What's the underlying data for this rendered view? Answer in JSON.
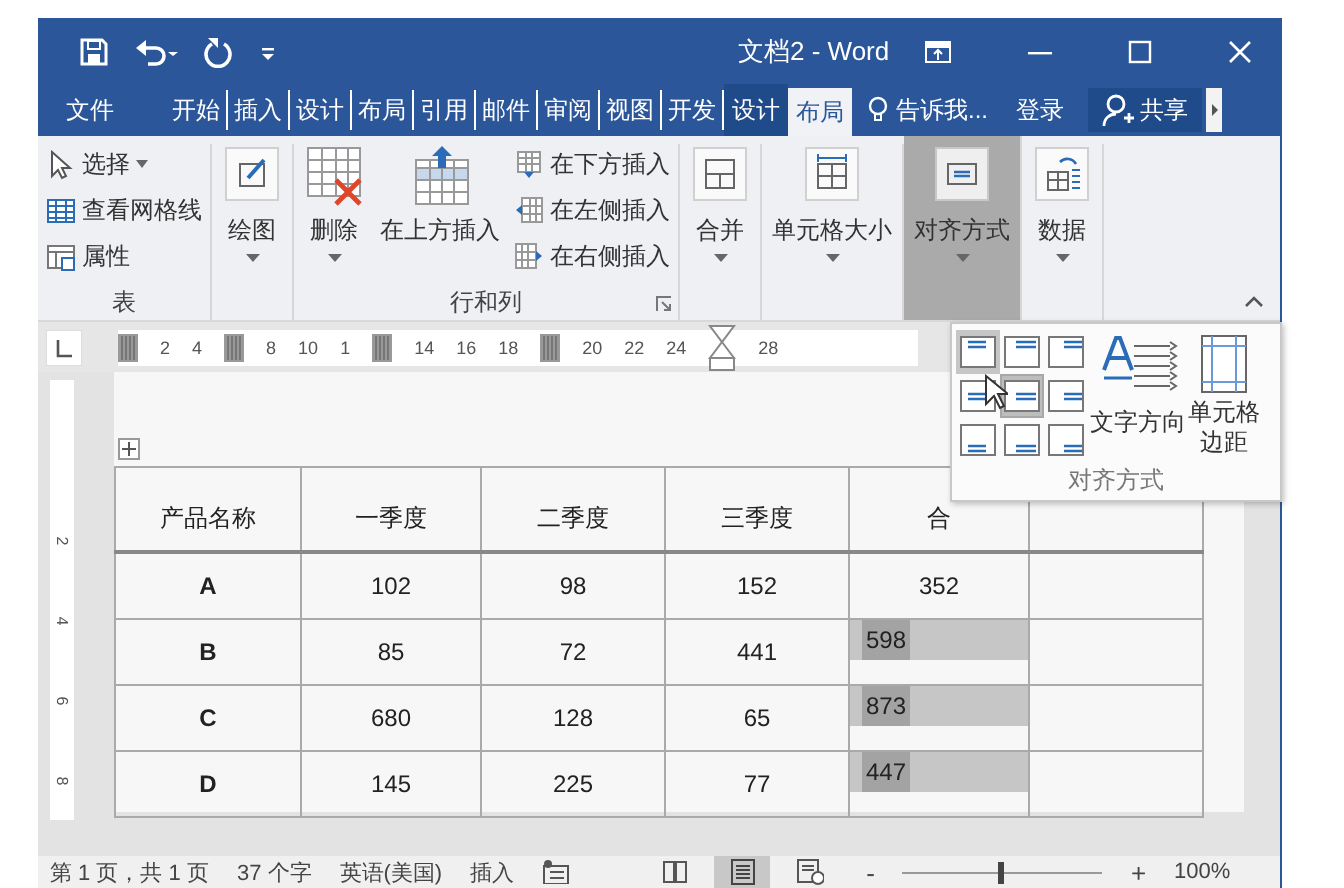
{
  "window": {
    "title": "文档2 - Word"
  },
  "tabs": [
    {
      "label": "文件",
      "selected": false,
      "kind": "file"
    },
    {
      "label": "开始",
      "selected": false,
      "kind": "normal"
    },
    {
      "label": "插入",
      "selected": false,
      "kind": "normal"
    },
    {
      "label": "设计",
      "selected": false,
      "kind": "normal"
    },
    {
      "label": "布局",
      "selected": false,
      "kind": "normal"
    },
    {
      "label": "引用",
      "selected": false,
      "kind": "normal"
    },
    {
      "label": "邮件",
      "selected": false,
      "kind": "normal"
    },
    {
      "label": "审阅",
      "selected": false,
      "kind": "normal"
    },
    {
      "label": "视图",
      "selected": false,
      "kind": "normal"
    },
    {
      "label": "开发",
      "selected": false,
      "kind": "normal"
    },
    {
      "label": "设计",
      "selected": false,
      "kind": "context"
    },
    {
      "label": "布局",
      "selected": true,
      "kind": "context"
    }
  ],
  "tell_me": "告诉我...",
  "sign_in": "登录",
  "share": "共享",
  "ribbon": [
    {
      "label": "表",
      "items": [
        {
          "kind": "small",
          "label": "选择",
          "dropdown": true
        },
        {
          "kind": "small",
          "label": "查看网格线",
          "dropdown": false
        },
        {
          "kind": "small",
          "label": "属性",
          "dropdown": false
        }
      ]
    },
    {
      "items": [
        {
          "kind": "large",
          "label": "绘图",
          "dropdown": true,
          "pressed": false
        }
      ]
    },
    {
      "label": "行和列",
      "launcher": true,
      "items": [
        {
          "kind": "large",
          "label": "删除",
          "dropdown": true,
          "pressed": false
        },
        {
          "kind": "large",
          "label": "在上方插入",
          "dropdown": false,
          "pressed": false
        },
        {
          "kind": "small",
          "label": "在下方插入",
          "dropdown": false
        },
        {
          "kind": "small",
          "label": "在左侧插入",
          "dropdown": false
        },
        {
          "kind": "small",
          "label": "在右侧插入",
          "dropdown": false
        }
      ]
    },
    {
      "items": [
        {
          "kind": "large",
          "label": "合并",
          "dropdown": true,
          "pressed": false
        }
      ]
    },
    {
      "items": [
        {
          "kind": "large",
          "label": "单元格大小",
          "dropdown": true,
          "pressed": false
        }
      ]
    },
    {
      "items": [
        {
          "kind": "large",
          "label": "对齐方式",
          "dropdown": true,
          "pressed": true
        }
      ]
    },
    {
      "items": [
        {
          "kind": "large",
          "label": "数据",
          "dropdown": true,
          "pressed": false
        }
      ]
    }
  ],
  "alignment_panel": {
    "label": "对齐方式",
    "cells": [
      {
        "selected": true,
        "hovered": false
      },
      {
        "selected": false,
        "hovered": false
      },
      {
        "selected": false,
        "hovered": false
      },
      {
        "selected": false,
        "hovered": false
      },
      {
        "selected": false,
        "hovered": true
      },
      {
        "selected": false,
        "hovered": false
      },
      {
        "selected": false,
        "hovered": false
      },
      {
        "selected": false,
        "hovered": false
      },
      {
        "selected": false,
        "hovered": false
      }
    ],
    "text_direction": "文字方向",
    "cell_margins": "单元格边距"
  },
  "ruler": {
    "numbers": [
      "2",
      "4",
      "8",
      "10",
      "1",
      "14",
      "16",
      "18",
      "20",
      "22",
      "24",
      "28"
    ],
    "vertical_numbers": [
      "2",
      "4",
      "6",
      "8"
    ]
  },
  "table": {
    "columns": [
      {
        "label": "产品名称"
      },
      {
        "label": "一季度"
      },
      {
        "label": "二季度"
      },
      {
        "label": "三季度"
      },
      {
        "label": "合"
      },
      {}
    ],
    "rows": [
      {
        "cells": [
          "A",
          "102",
          "98",
          "152",
          "352"
        ],
        "total_selected": false
      },
      {
        "cells": [
          "B",
          "85",
          "72",
          "441",
          "598"
        ],
        "total_selected": true
      },
      {
        "cells": [
          "C",
          "680",
          "128",
          "65",
          "873"
        ],
        "total_selected": true
      },
      {
        "cells": [
          "D",
          "145",
          "225",
          "77",
          "447"
        ],
        "total_selected": true
      }
    ]
  },
  "status_bar": {
    "page": "第 1 页，共 1 页",
    "words": "37 个字",
    "language": "英语(美国)",
    "mode": "插入",
    "views": [
      {
        "selected": false
      },
      {
        "selected": true
      },
      {
        "selected": false
      }
    ],
    "zoom_out": "-",
    "zoom_in": "+",
    "zoom": {
      "level": 0.5
    },
    "zoom_text": "100%"
  }
}
